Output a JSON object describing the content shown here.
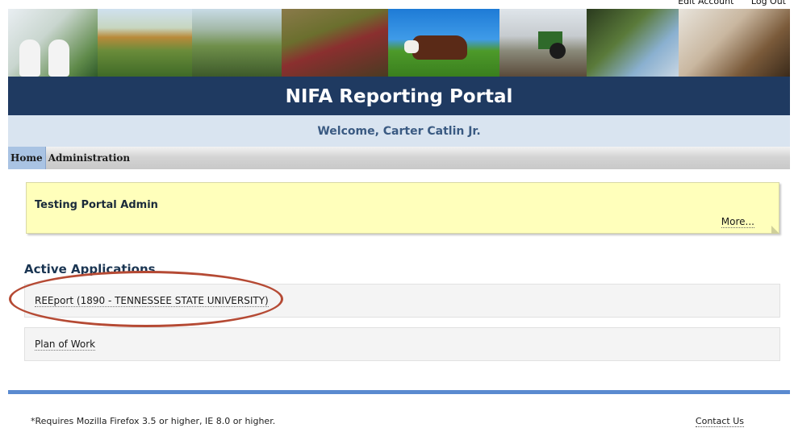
{
  "header": {
    "links": {
      "edit_account": "Edit Account",
      "logout": "Log Out"
    },
    "title": "NIFA Reporting Portal",
    "welcome": "Welcome, Carter Catlin Jr."
  },
  "nav": {
    "tabs": [
      {
        "label": "Home",
        "active": true
      },
      {
        "label": "Administration",
        "active": false
      }
    ]
  },
  "notice": {
    "title": "Testing Portal Admin",
    "more_label": "More..."
  },
  "applications": {
    "title": "Active Applications",
    "items": [
      {
        "label": "REEport (1890 - TENNESSEE STATE UNIVERSITY)"
      },
      {
        "label": "Plan of Work"
      }
    ]
  },
  "footer": {
    "note": "*Requires Mozilla Firefox 3.5 or higher, IE 8.0 or higher.",
    "contact": "Contact Us"
  },
  "colors": {
    "title_bar": "#1f3a61",
    "welcome_bar": "#d9e4f0",
    "notice_bg": "#ffffbb",
    "footer_rule": "#5a8ad0",
    "highlight": "#b54a34"
  }
}
